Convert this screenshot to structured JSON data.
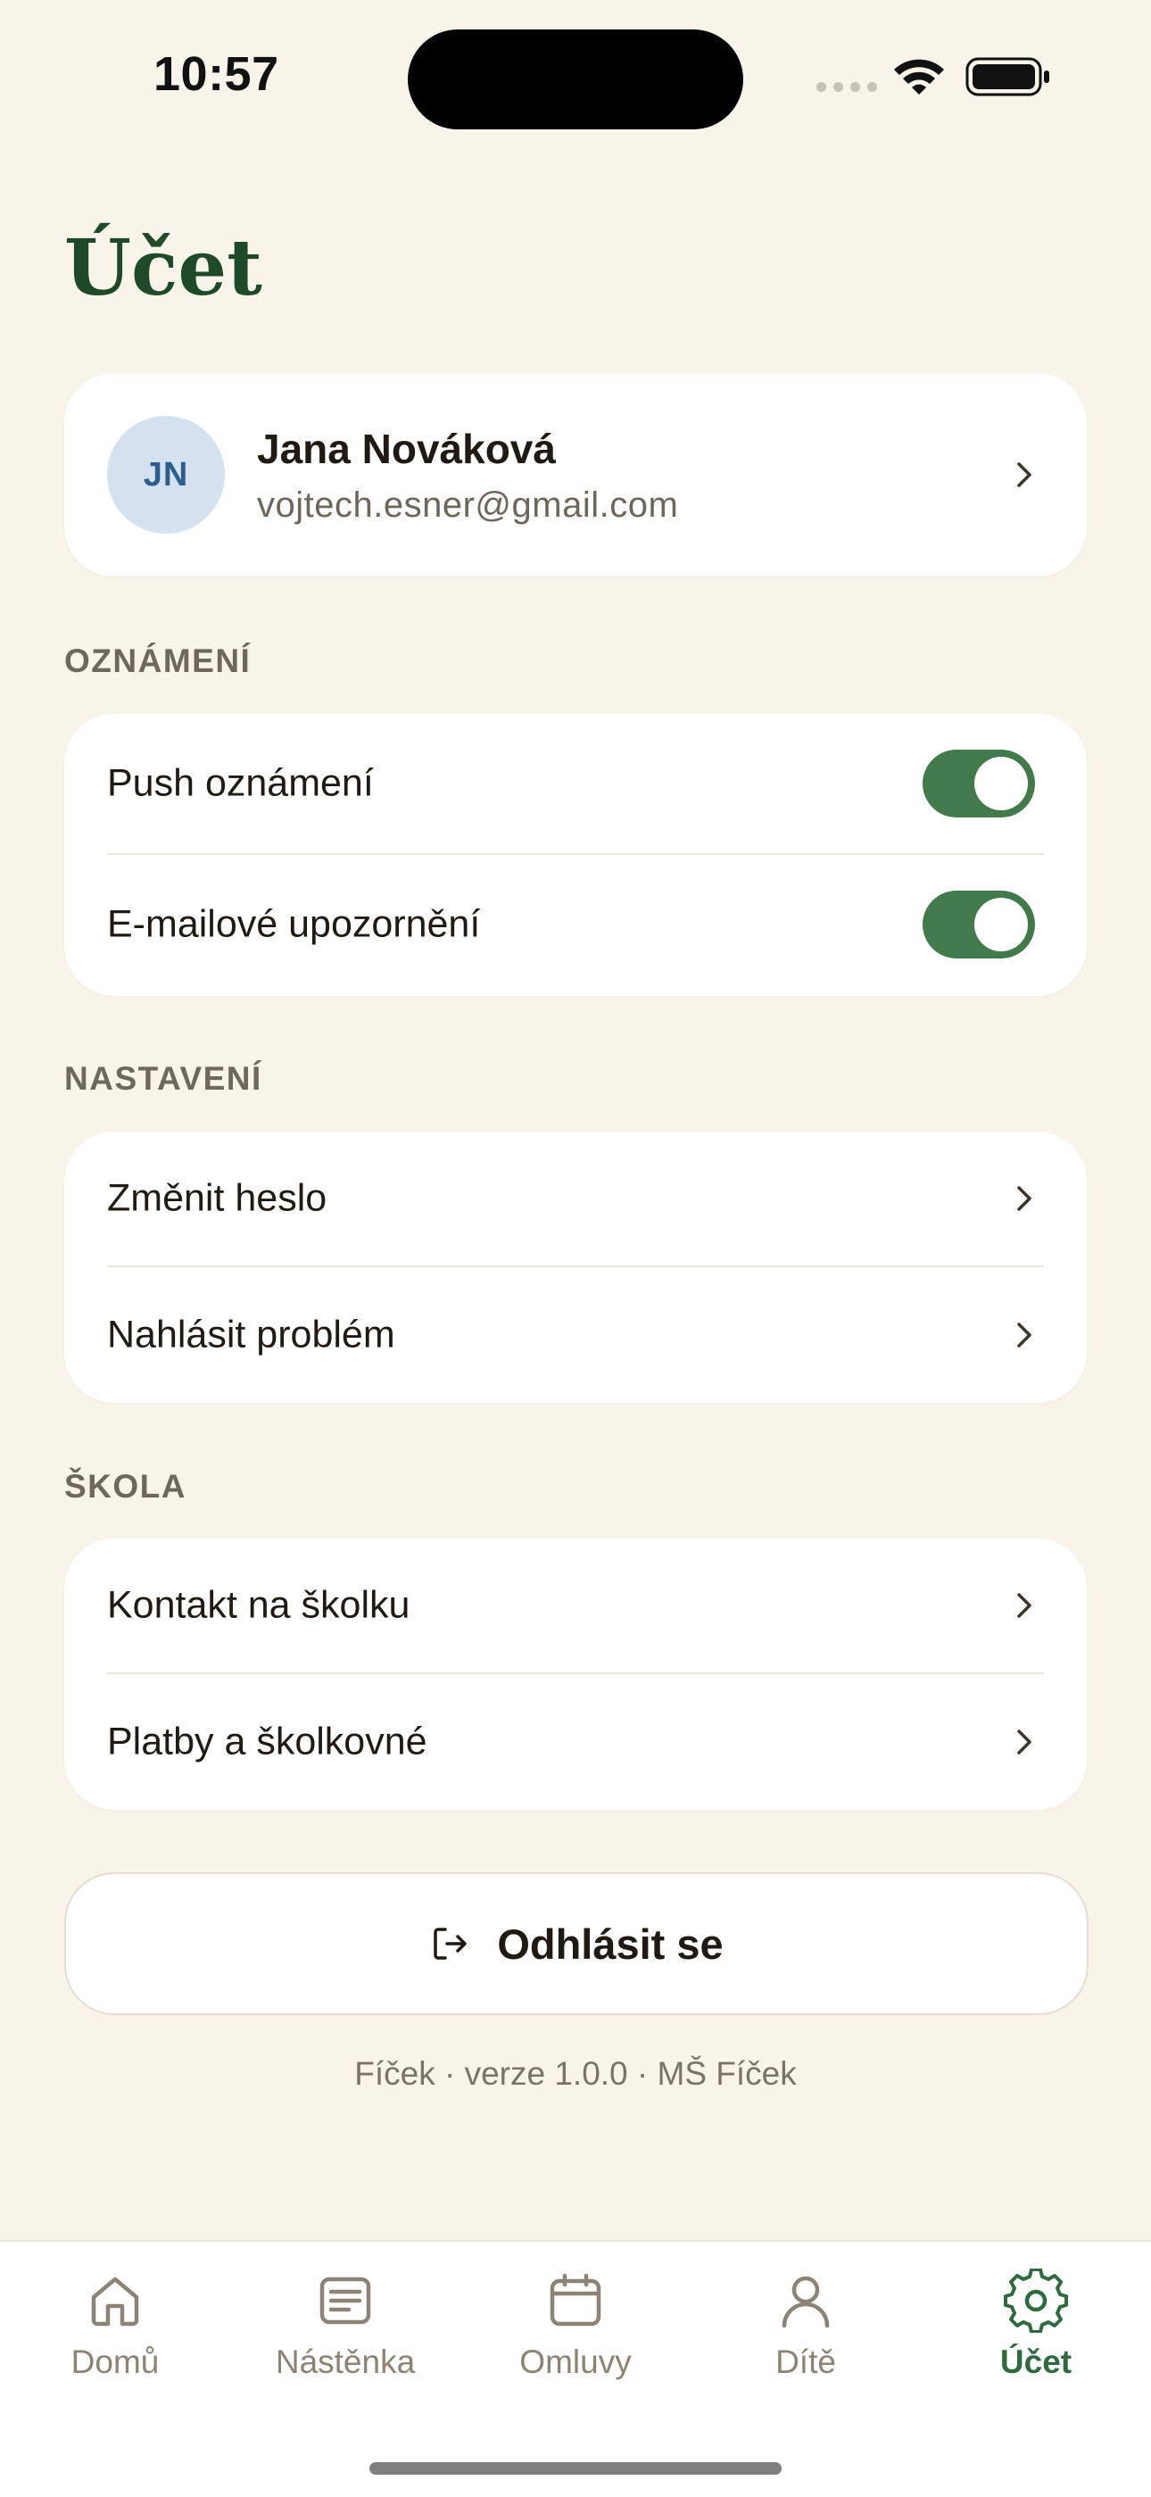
{
  "status_bar": {
    "time": "10:57"
  },
  "page": {
    "title": "Účet"
  },
  "profile": {
    "initials": "JN",
    "name": "Jana Nováková",
    "email": "vojtech.esner@gmail.com"
  },
  "notifications": {
    "label": "OZNÁMENÍ",
    "items": [
      {
        "label": "Push oznámení",
        "enabled": true
      },
      {
        "label": "E-mailové upozornění",
        "enabled": true
      }
    ]
  },
  "settings": {
    "label": "NASTAVENÍ",
    "items": [
      {
        "label": "Změnit heslo"
      },
      {
        "label": "Nahlásit problém"
      }
    ]
  },
  "school": {
    "label": "ŠKOLA",
    "items": [
      {
        "label": "Kontakt na školku"
      },
      {
        "label": "Platby a školkovné"
      }
    ]
  },
  "logout": {
    "label": "Odhlásit se"
  },
  "footer": {
    "text": "Fíček · verze 1.0.0 · MŠ Fíček"
  },
  "tabs": [
    {
      "label": "Domů",
      "icon": "home-icon",
      "active": false
    },
    {
      "label": "Nástěnka",
      "icon": "board-icon",
      "active": false
    },
    {
      "label": "Omluvy",
      "icon": "calendar-icon",
      "active": false
    },
    {
      "label": "Dítě",
      "icon": "person-icon",
      "active": false
    },
    {
      "label": "Účet",
      "icon": "gear-icon",
      "active": true
    }
  ],
  "colors": {
    "background": "#f8f4ea",
    "accent": "#2f6a3f",
    "toggle_on": "#427a4b",
    "title": "#1f4a2a"
  }
}
